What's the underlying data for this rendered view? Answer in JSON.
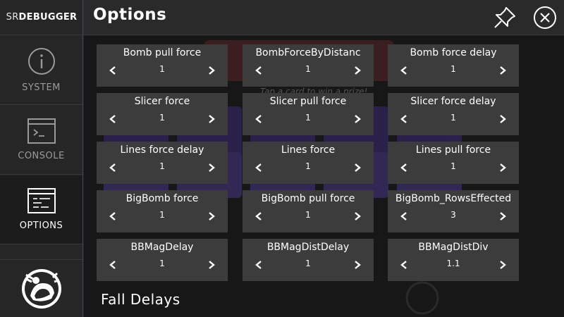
{
  "brand": {
    "prefix": "SR",
    "name": "DEBUGGER"
  },
  "sidebar": {
    "items": [
      {
        "label": "SYSTEM"
      },
      {
        "label": "CONSOLE"
      },
      {
        "label": "OPTIONS"
      }
    ]
  },
  "header": {
    "title": "Options"
  },
  "background": {
    "overlay_text": "Tap a card to win a prize!"
  },
  "options": [
    {
      "name": "Bomb pull force",
      "value": "1"
    },
    {
      "name": "BombForceByDistanc",
      "value": "1"
    },
    {
      "name": "Bomb force delay",
      "value": "1"
    },
    {
      "name": "Slicer force",
      "value": "1"
    },
    {
      "name": "Slicer pull force",
      "value": "1"
    },
    {
      "name": "Slicer force delay",
      "value": "1"
    },
    {
      "name": "Lines force delay",
      "value": "1"
    },
    {
      "name": "Lines force",
      "value": "1"
    },
    {
      "name": "Lines pull force",
      "value": "1"
    },
    {
      "name": "BigBomb force",
      "value": "1"
    },
    {
      "name": "BigBomb pull force",
      "value": "1"
    },
    {
      "name": "BigBomb_RowsEffected",
      "value": "3"
    },
    {
      "name": "BBMagDelay",
      "value": "1"
    },
    {
      "name": "BBMagDistDelay",
      "value": "1"
    },
    {
      "name": "BBMagDistDiv",
      "value": "1.1"
    }
  ],
  "section": {
    "title": "Fall Delays"
  },
  "colors": {
    "accent_border": "#3d4d63",
    "card": "#3c3c3c",
    "background": "#171717"
  }
}
